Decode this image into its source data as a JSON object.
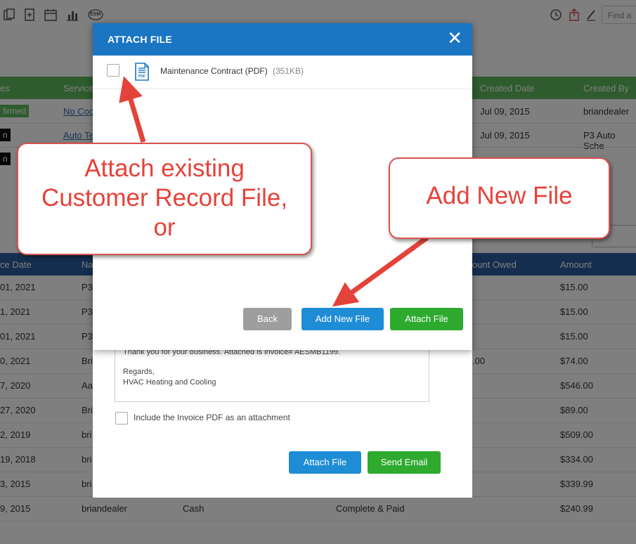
{
  "toolbar": {
    "esm_label": "ESM",
    "search_placeholder": "Find a"
  },
  "services_table": {
    "headers": [
      "es",
      "Service",
      "Created Date",
      "Created By"
    ],
    "rows": [
      {
        "status": "firmed",
        "service": "No Coo",
        "created_date": "Jul 09, 2015",
        "created_by": "briandealer"
      },
      {
        "status": "n",
        "service": "Auto Te",
        "created_date": "Jul 09, 2015",
        "created_by": "P3 Auto Sche"
      },
      {
        "status": "n",
        "service": "",
        "created_date": "",
        "created_by": ""
      }
    ]
  },
  "invoices_table": {
    "headers": [
      "ce Date",
      "Na",
      "ount Owed",
      "Amount"
    ],
    "rows": [
      {
        "date": "01, 2021",
        "name": "P3",
        "payment": "",
        "status": "",
        "owed": "",
        "amount": "$15.00"
      },
      {
        "date": "1, 2021",
        "name": "P3",
        "payment": "",
        "status": "",
        "owed": "",
        "amount": "$15.00"
      },
      {
        "date": "01, 2021",
        "name": "P3",
        "payment": "",
        "status": "",
        "owed": "",
        "amount": "$15.00"
      },
      {
        "date": "0, 2021",
        "name": "Bri",
        "payment": "",
        "status": "",
        "owed": ".00",
        "amount": "$74.00"
      },
      {
        "date": "7, 2020",
        "name": "Aa",
        "payment": "",
        "status": "",
        "owed": "",
        "amount": "$546.00"
      },
      {
        "date": "27, 2020",
        "name": "Bri",
        "payment": "",
        "status": "",
        "owed": "",
        "amount": "$89.00"
      },
      {
        "date": "2, 2019",
        "name": "bri",
        "payment": "",
        "status": "",
        "owed": "",
        "amount": "$509.00"
      },
      {
        "date": "19, 2018",
        "name": "bri",
        "payment": "",
        "status": "",
        "owed": "",
        "amount": "$334.00"
      },
      {
        "date": "3, 2015",
        "name": "bri",
        "payment": "",
        "status": "",
        "owed": "",
        "amount": "$339.99"
      },
      {
        "date": "9, 2015",
        "name": "briandealer",
        "payment": "Cash",
        "status": "Complete & Paid",
        "owed": "",
        "amount": "$240.99"
      }
    ]
  },
  "email_modal": {
    "body_line1": "Thank you for your business.  Attached is invoice# AESMB1199.",
    "body_line2": "Regards,",
    "body_line3": "HVAC Heating and Cooling",
    "include_pdf_label": "Include the Invoice PDF as an attachment",
    "attach_file_button": "Attach File",
    "send_email_button": "Send Email"
  },
  "attach_modal": {
    "title": "ATTACH FILE",
    "close_symbol": "✕",
    "file": {
      "name": "Maintenance Contract (PDF)",
      "size": "(351KB)",
      "icon_label": "PDF",
      "checked": false
    },
    "back_button": "Back",
    "add_new_file_button": "Add New File",
    "attach_file_button": "Attach File"
  },
  "callouts": {
    "left": [
      "Attach existing",
      "Customer Record File,",
      "or"
    ],
    "right": "Add New File"
  },
  "colors": {
    "modal_header": "#1a75c2",
    "green_button": "#2eaa2e",
    "blue_button": "#1f8dd6",
    "back_button": "#9e9e9e",
    "callout_red": "#e5423a"
  }
}
